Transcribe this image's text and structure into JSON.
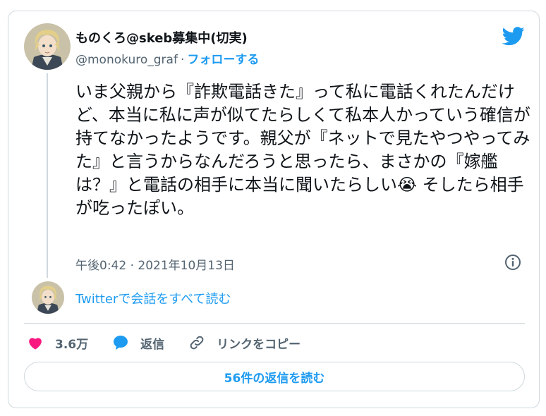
{
  "author": {
    "name": "ものくろ@skeb募集中(切実)",
    "handle": "@monokuro_graf",
    "separator": "·",
    "follow_label": "フォローする"
  },
  "tweet": {
    "text": "いま父親から『詐欺電話きた』って私に電話くれたんだけど、本当に私に声が似てたらしくて私本人かっていう確信が持てなかったようです。親父が『ネットで見たやつやってみた』と言うからなんだろうと思ったら、まさかの『嫁艦は？』と電話の相手に本当に聞いたらしい😭 そしたら相手が吃ったぽい。",
    "timestamp": "午後0:42 · 2021年10月13日"
  },
  "conversation": {
    "read_all_label": "Twitterで会話をすべて読む"
  },
  "actions": {
    "likes_count": "3.6万",
    "reply_label": "返信",
    "copy_link_label": "リンクをコピー"
  },
  "replies_button_label": "56件の返信を読む",
  "colors": {
    "accent": "#1d9bf0",
    "like": "#f91880",
    "secondary_text": "#536471",
    "border": "#cfd9de"
  },
  "icons": [
    "twitter-bird-icon",
    "info-icon",
    "heart-icon",
    "reply-bubble-icon",
    "link-icon"
  ]
}
